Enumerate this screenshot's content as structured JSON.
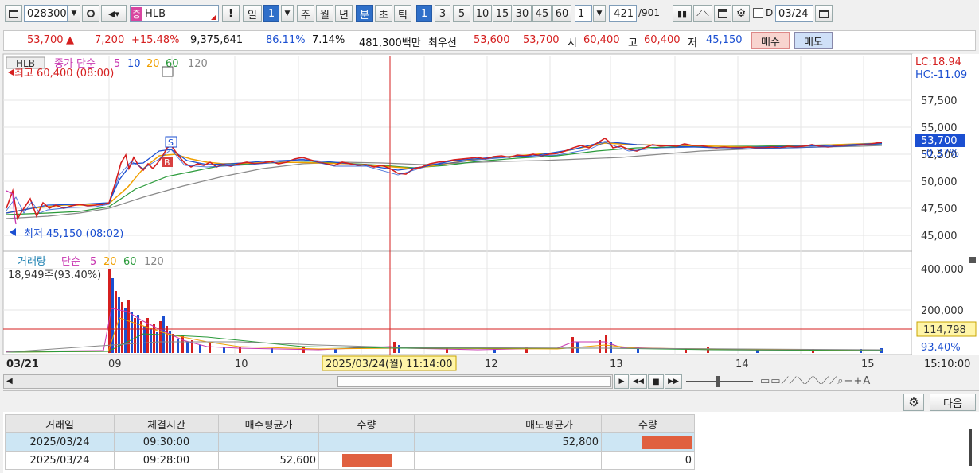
{
  "toolbar": {
    "code": "028300",
    "badge": "증",
    "name": "HLB",
    "alert": "!",
    "periods": [
      "일",
      "1",
      "주",
      "월",
      "년",
      "분",
      "초",
      "틱",
      "1",
      "3",
      "5",
      "10",
      "15",
      "30",
      "45",
      "60"
    ],
    "selected_periods": [
      "1",
      "분",
      "1"
    ],
    "interval_value": "1",
    "count_current": "421",
    "count_total": "/901",
    "check_label": "D",
    "date_value": "03/24"
  },
  "quote": {
    "price": "53,700",
    "arrow": "▲",
    "change": "7,200",
    "change_pct": "+15.48%",
    "volume": "9,375,641",
    "ratio": "86.11%",
    "turnover_pct": "7.14%",
    "amount": "481,300백만",
    "best_label": "최우선",
    "best_ask": "53,600",
    "best_bid": "53,700",
    "open_label": "시",
    "open": "60,400",
    "high_label": "고",
    "high": "60,400",
    "low_label": "저",
    "low": "45,150",
    "buy_button": "매수",
    "sell_button": "매도"
  },
  "price_panel": {
    "symbol": "HLB",
    "ma_label": "종가 단순",
    "ma_periods": [
      "5",
      "10",
      "20",
      "60",
      "120"
    ],
    "high_marker": "최고 60,400 (08:00)",
    "low_marker": "최저 45,150 (08:02)",
    "lc": "LC:18.94",
    "hc": "HC:-11.09",
    "y_ticks": [
      "57,500",
      "55,000",
      "52,500",
      "50,000",
      "47,500",
      "45,000"
    ],
    "current_price": "53,700",
    "current_pct": "-0.37%",
    "signal_s": "S",
    "signal_b": "B"
  },
  "volume_panel": {
    "title": "거래량",
    "ma_label": "단순",
    "ma_periods": [
      "5",
      "20",
      "60",
      "120"
    ],
    "last_volume": "18,949주(93.40%)",
    "y_ticks": [
      "400,000",
      "200,000"
    ],
    "current_volume": "114,798",
    "current_pct": "93.40%"
  },
  "time_axis": {
    "start": "03/21",
    "labels": [
      "09",
      "10",
      "12",
      "13",
      "14",
      "15"
    ],
    "cursor_label": "2025/03/24(월) 11:14:00",
    "end_time": "15:10:00"
  },
  "bottom": {
    "next_button": "다음",
    "columns": [
      "거래일",
      "체결시간",
      "매수평균가",
      "수량",
      "",
      "매도평균가",
      "수량"
    ],
    "rows": [
      {
        "date": "2025/03/24",
        "time": "09:30:00",
        "buy_avg": "",
        "buy_qty_bar": false,
        "sell_avg": "52,800",
        "sell_qty": "",
        "sell_qty_bar": true
      },
      {
        "date": "2025/03/24",
        "time": "09:28:00",
        "buy_avg": "52,600",
        "buy_qty_bar": true,
        "sell_avg": "",
        "sell_qty": "0",
        "sell_qty_bar": false
      }
    ]
  },
  "colors": {
    "up": "#d51f1f",
    "down": "#1b4fd1",
    "accent": "#2f6fc9",
    "bar_fill": "#e06040"
  }
}
